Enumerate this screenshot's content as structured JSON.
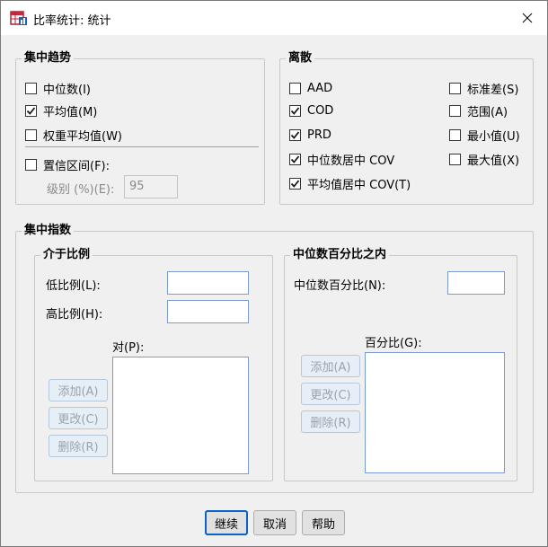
{
  "window": {
    "title": "比率统计: 统计"
  },
  "icons": {
    "app": "table-chart-icon",
    "close": "close-icon",
    "check": "checkmark-icon"
  },
  "central": {
    "title": "集中趋势",
    "median": {
      "label": "中位数(I)",
      "checked": false
    },
    "mean": {
      "label": "平均值(M)",
      "checked": true
    },
    "weighted_mean": {
      "label": "权重平均值(W)",
      "checked": false
    },
    "ci": {
      "label": "置信区间(F):",
      "checked": false
    },
    "level_label": "级别 (%)(E):",
    "level_value": "95"
  },
  "dispersion": {
    "title": "离散",
    "aad": {
      "label": "AAD",
      "checked": false
    },
    "cod": {
      "label": "COD",
      "checked": true
    },
    "prd": {
      "label": "PRD",
      "checked": true
    },
    "median_cov": {
      "label": "中位数居中 COV",
      "checked": true
    },
    "mean_cov": {
      "label": "平均值居中 COV(T)",
      "checked": true
    },
    "std_dev": {
      "label": "标准差(S)",
      "checked": false
    },
    "range": {
      "label": "范围(A)",
      "checked": false
    },
    "minimum": {
      "label": "最小值(U)",
      "checked": false
    },
    "maximum": {
      "label": "最大值(X)",
      "checked": false
    }
  },
  "concentration": {
    "title": "集中指数",
    "between": {
      "title": "介于比例",
      "low_label": "低比例(L):",
      "high_label": "高比例(H):",
      "pairs_label": "对(P):",
      "add_label": "添加(A)",
      "change_label": "更改(C)",
      "remove_label": "删除(R)"
    },
    "within": {
      "title": "中位数百分比之内",
      "pct_median_label": "中位数百分比(N):",
      "percentages_label": "百分比(G):",
      "add_label": "添加(A)",
      "change_label": "更改(C)",
      "remove_label": "删除(R)"
    }
  },
  "buttons": {
    "continue": "继续",
    "cancel": "取消",
    "help": "帮助"
  },
  "colors": {
    "accent": "#0a64c8",
    "check": "#1a1a1a"
  }
}
